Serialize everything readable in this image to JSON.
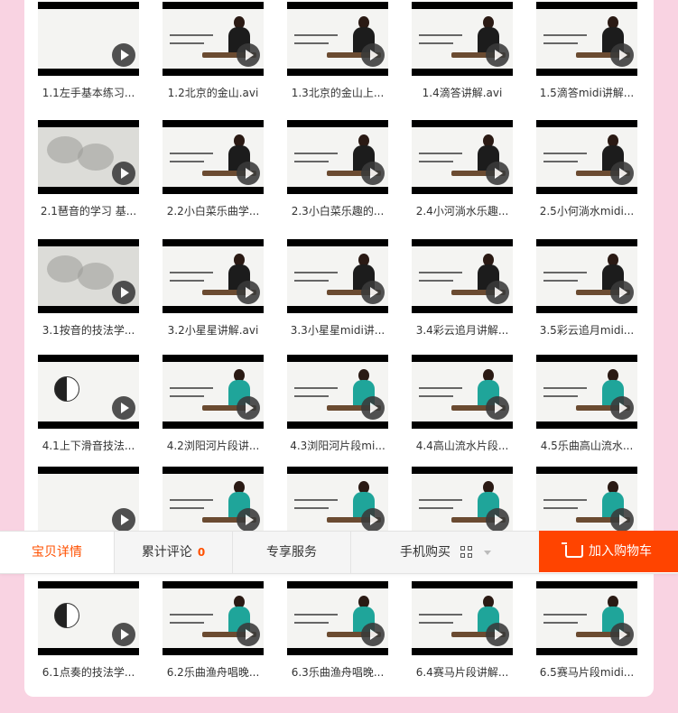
{
  "rows": [
    {
      "items": [
        {
          "label": "1.1左手基本练习...",
          "thumb": "scene-empty"
        },
        {
          "label": "1.2北京的金山.avi",
          "thumb": "scene-black"
        },
        {
          "label": "1.3北京的金山上...",
          "thumb": "scene-black"
        },
        {
          "label": "1.4滴答讲解.avi",
          "thumb": "scene-black"
        },
        {
          "label": "1.5滴答midi讲解...",
          "thumb": "scene-black"
        }
      ]
    },
    {
      "items": [
        {
          "label": "2.1琶音的学习 基...",
          "thumb": "ink"
        },
        {
          "label": "2.2小白菜乐曲学...",
          "thumb": "scene-black"
        },
        {
          "label": "2.3小白菜乐趣的...",
          "thumb": "scene-black"
        },
        {
          "label": "2.4小河淌水乐趣...",
          "thumb": "scene-black"
        },
        {
          "label": "2.5小何淌水midi...",
          "thumb": "scene-black"
        }
      ]
    },
    {
      "items": [
        {
          "label": "3.1按音的技法学...",
          "thumb": "ink"
        },
        {
          "label": "3.2小星星讲解.avi",
          "thumb": "scene-black"
        },
        {
          "label": "3.3小星星midi讲...",
          "thumb": "scene-black"
        },
        {
          "label": "3.4彩云追月讲解...",
          "thumb": "scene-black"
        },
        {
          "label": "3.5彩云追月midi...",
          "thumb": "scene-black"
        }
      ]
    },
    {
      "items": [
        {
          "label": "4.1上下滑音技法...",
          "thumb": "yinyang"
        },
        {
          "label": "4.2浏阳河片段讲...",
          "thumb": "scene-teal"
        },
        {
          "label": "4.3浏阳河片段mi...",
          "thumb": "scene-teal"
        },
        {
          "label": "4.4高山流水片段...",
          "thumb": "scene-teal"
        },
        {
          "label": "4.5乐曲高山流水...",
          "thumb": "scene-teal"
        }
      ]
    },
    {
      "items": [
        {
          "label": "",
          "thumb": "scene-empty"
        },
        {
          "label": "",
          "thumb": "scene-teal"
        },
        {
          "label": "",
          "thumb": "scene-teal"
        },
        {
          "label": "",
          "thumb": "scene-teal"
        },
        {
          "label": "",
          "thumb": "scene-teal"
        }
      ]
    },
    {
      "items": [
        {
          "label": "6.1点奏的技法学...",
          "thumb": "yinyang"
        },
        {
          "label": "6.2乐曲渔舟唱晚...",
          "thumb": "scene-teal"
        },
        {
          "label": "6.3乐曲渔舟唱晚...",
          "thumb": "scene-teal"
        },
        {
          "label": "6.4赛马片段讲解...",
          "thumb": "scene-teal"
        },
        {
          "label": "6.5赛马片段midi...",
          "thumb": "scene-teal"
        }
      ]
    }
  ],
  "tabs": {
    "details": "宝贝详情",
    "reviews": "累计评论",
    "review_count": "0",
    "service": "专享服务",
    "mobile_buy": "手机购买",
    "add_to_cart": "加入购物车"
  },
  "colors": {
    "accent": "#ff5000",
    "cart_bg": "#ff4400",
    "page_bg": "#f9d3e2"
  }
}
